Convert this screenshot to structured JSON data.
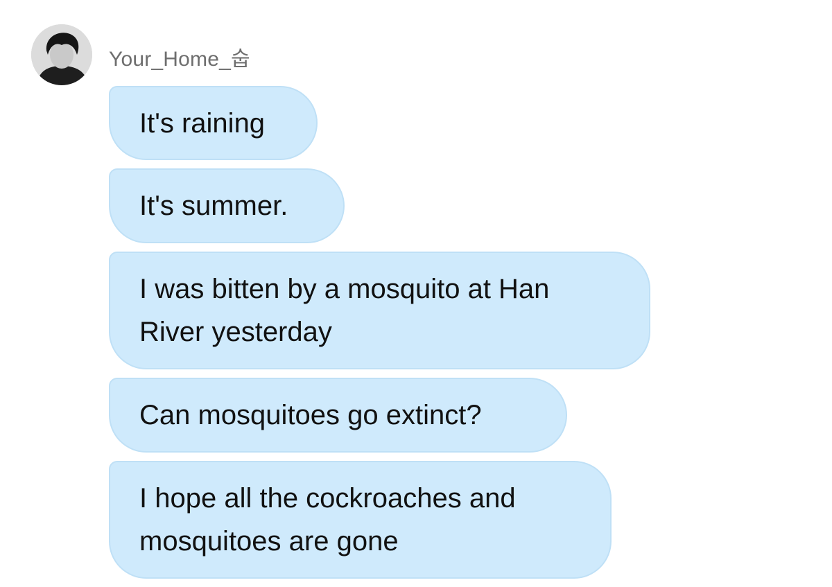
{
  "sender": {
    "name": "Your_Home_숩",
    "avatar_icon": "profile-photo-avatar"
  },
  "messages": [
    {
      "lines": [
        "It's raining"
      ]
    },
    {
      "lines": [
        "It's summer."
      ]
    },
    {
      "lines": [
        "I was bitten by a mosquito at Han",
        "River yesterday"
      ]
    },
    {
      "lines": [
        "Can mosquitoes go extinct?"
      ]
    },
    {
      "lines": [
        "I hope all the cockroaches and",
        "mosquitoes are gone"
      ]
    }
  ],
  "colors": {
    "bubble_fill": "#cfeafc",
    "bubble_border": "#bfe0f6",
    "sender_name": "#6e6e6e",
    "message_text": "#111111"
  }
}
